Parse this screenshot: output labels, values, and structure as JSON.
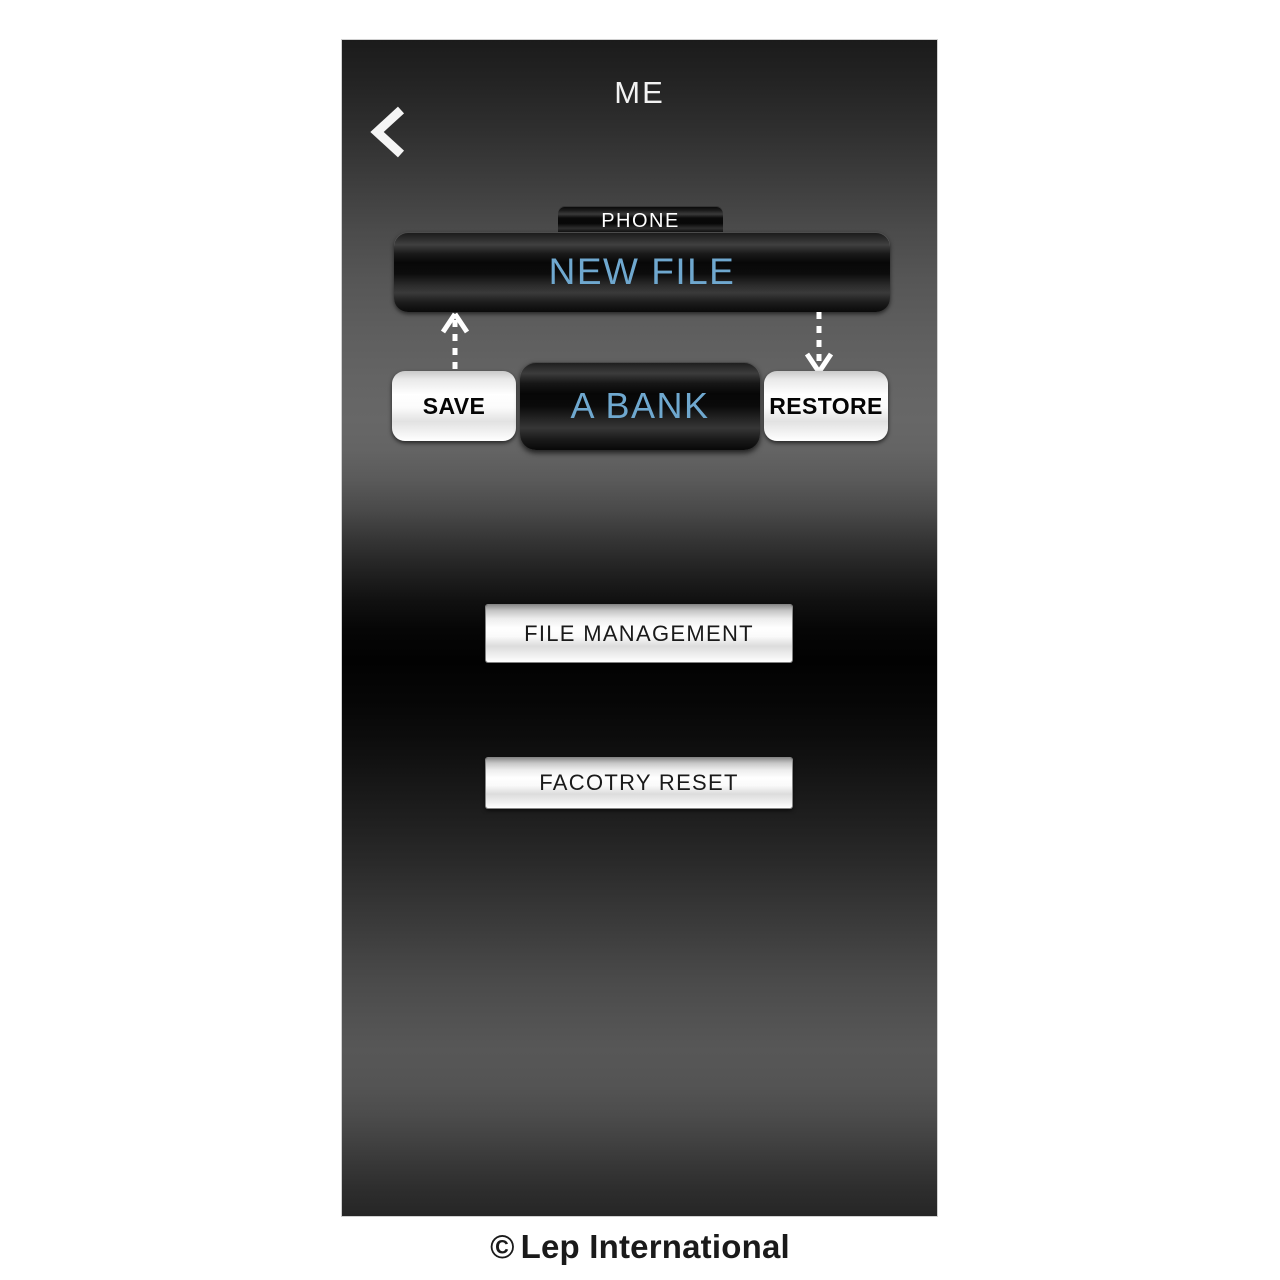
{
  "app": {
    "title": "ME",
    "back_icon": "chevron-left-icon"
  },
  "content": {
    "source_tab": {
      "label": "PHONE",
      "icon": "tab-shape"
    },
    "file_row": {
      "label": "NEW FILE",
      "accent_color": "#6fa8cf"
    },
    "transfer": {
      "save_label": "SAVE",
      "restore_label": "RESTORE",
      "bank_label": "A BANK",
      "save_arrow_icon": "arrow-up-dashed-icon",
      "restore_arrow_icon": "arrow-down-dashed-icon"
    },
    "actions": [
      {
        "label": "FILE MANAGEMENT",
        "name": "file-management"
      },
      {
        "label": "FACOTRY RESET",
        "name": "factory-reset"
      }
    ]
  },
  "footer": {
    "copyright_symbol": "©",
    "credit": "Lep International"
  },
  "theme": {
    "accent": "#6fa8cf",
    "panel_bg_top": "#1b1b1b",
    "panel_bg_mid": "#676767",
    "silver": "#ffffff",
    "page_bg": "#ffffff"
  }
}
